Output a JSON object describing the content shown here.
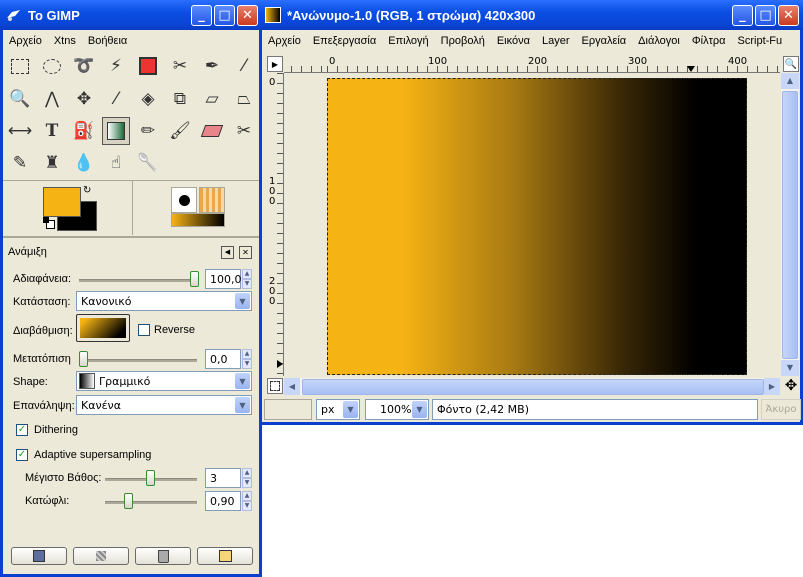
{
  "toolbox": {
    "title": "To GIMP",
    "menu": [
      "Αρχείο",
      "Xtns",
      "Βοήθεια"
    ],
    "colors": {
      "fg": "#f5b314",
      "bg": "#000000"
    },
    "dock_title": "Ανάμιξη",
    "options": {
      "opacity_label": "Αδιαφάνεια:",
      "opacity_value": "100,0",
      "opacity_fraction": 1.0,
      "mode_label": "Κατάσταση:",
      "mode_value": "Κανονικό",
      "gradient_label": "Διαβάθμιση:",
      "reverse_label": "Reverse",
      "offset_label": "Μετατόπιση",
      "offset_value": "0,0",
      "offset_fraction": 0.0,
      "shape_label": "Shape:",
      "shape_value": "Γραμμικό",
      "repeat_label": "Επανάληψη:",
      "repeat_value": "Κανένα",
      "dithering_label": "Dithering",
      "adaptive_label": "Adaptive supersampling",
      "depth_label": "Μέγιστο Βάθος:",
      "depth_value": "3",
      "depth_fraction": 0.45,
      "threshold_label": "Κατώφλι:",
      "threshold_value": "0,90",
      "threshold_fraction": 0.22
    }
  },
  "image_window": {
    "title": "*Ανώνυμο-1.0 (RGB, 1 στρώμα) 420x300",
    "menu": [
      "Αρχείο",
      "Επεξεργασία",
      "Επιλογή",
      "Προβολή",
      "Εικόνα",
      "Layer",
      "Εργαλεία",
      "Διάλογοι",
      "Φίλτρα",
      "Script-Fu"
    ],
    "hruler": [
      "0",
      "100",
      "200",
      "300",
      "400"
    ],
    "vruler": [
      "0",
      "1\n0\n0",
      "2\n0\n0"
    ],
    "status": {
      "unit": "px",
      "zoom": "100%",
      "info": "Φόντο (2,42 MB)",
      "cancel": "Άκυρο"
    },
    "gradient": {
      "start": "#f5b314",
      "end": "#000000"
    }
  }
}
